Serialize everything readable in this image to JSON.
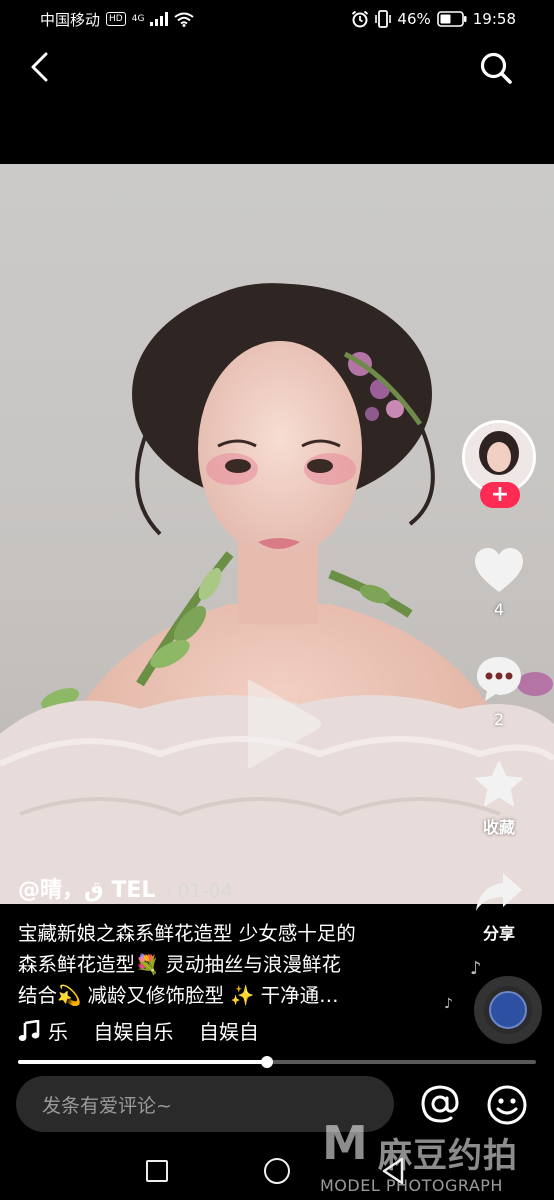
{
  "status_bar": {
    "carrier": "中国移动",
    "hd": "HD",
    "network": "4G",
    "battery": "46%",
    "time": "19:58"
  },
  "icons": {
    "back": "back-chevron-icon",
    "search": "search-icon",
    "play": "play-icon",
    "like": "heart-icon",
    "comment": "comment-bubble-icon",
    "favorite": "star-icon",
    "share": "share-arrow-icon",
    "music": "music-note-icon",
    "mention": "at-icon",
    "emoji": "smiley-icon"
  },
  "rail": {
    "follow": "+",
    "likes": "4",
    "comments": "2",
    "favorite_label": "收藏",
    "share_label": "分享"
  },
  "post": {
    "author": "@晴，ق TEL",
    "date": "· 01-04",
    "caption_lines": [
      "宝藏新娘之森系鲜花造型 少女感十足的",
      "森系鲜花造型💐 灵动抽丝与浪漫鲜花",
      "结合💫 减龄又修饰脸型 ✨ 干净通…"
    ],
    "music": "乐    自娱自乐    自娱自"
  },
  "progress": {
    "value": 0.48
  },
  "comment": {
    "placeholder": "发条有爱评论~"
  },
  "watermark": {
    "logo_letter": "M",
    "logo_cn": "麻豆约拍",
    "logo_en": "MODEL PHOTOGRAPH"
  },
  "colors": {
    "accent": "#fe2c55",
    "background": "#000000"
  }
}
